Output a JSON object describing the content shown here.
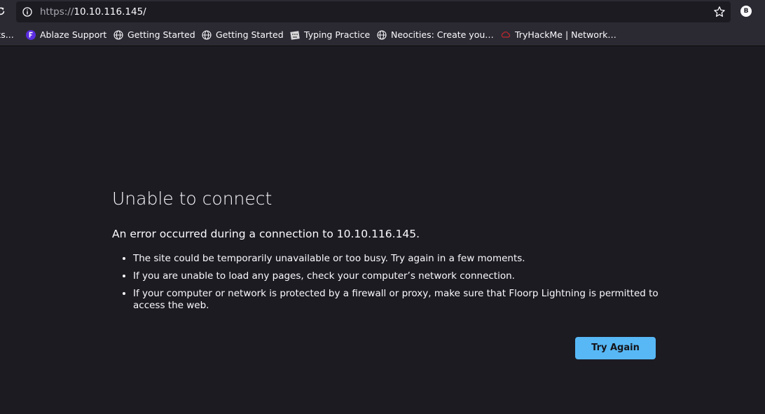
{
  "toolbar": {
    "url_scheme": "https://",
    "url_host": "10.10.116.145/",
    "account_initial": "B"
  },
  "bookmarks": [
    {
      "label": "ks...",
      "icon": "none"
    },
    {
      "label": "Ablaze Support",
      "icon": "ablaze-logo"
    },
    {
      "label": "Getting Started",
      "icon": "globe-icon"
    },
    {
      "label": "Getting Started",
      "icon": "globe-icon"
    },
    {
      "label": "Typing Practice",
      "icon": "typing-site-icon"
    },
    {
      "label": "Neocities: Create you…",
      "icon": "globe-icon"
    },
    {
      "label": "TryHackMe | Network…",
      "icon": "tryhackme-logo"
    }
  ],
  "error": {
    "title": "Unable to connect",
    "description": "An error occurred during a connection to 10.10.116.145.",
    "reasons": [
      "The site could be temporarily unavailable or too busy. Try again in a few moments.",
      "If you are unable to load any pages, check your computer’s network connection.",
      "If your computer or network is protected by a firewall or proxy, make sure that Floorp Lightning is permitted to access the web."
    ],
    "button_label": "Try Again"
  },
  "colors": {
    "toolbar_bg": "#2b2a33",
    "page_bg": "#1c1b22",
    "text": "#fbfbfe",
    "button_bg": "#57b8f5"
  }
}
